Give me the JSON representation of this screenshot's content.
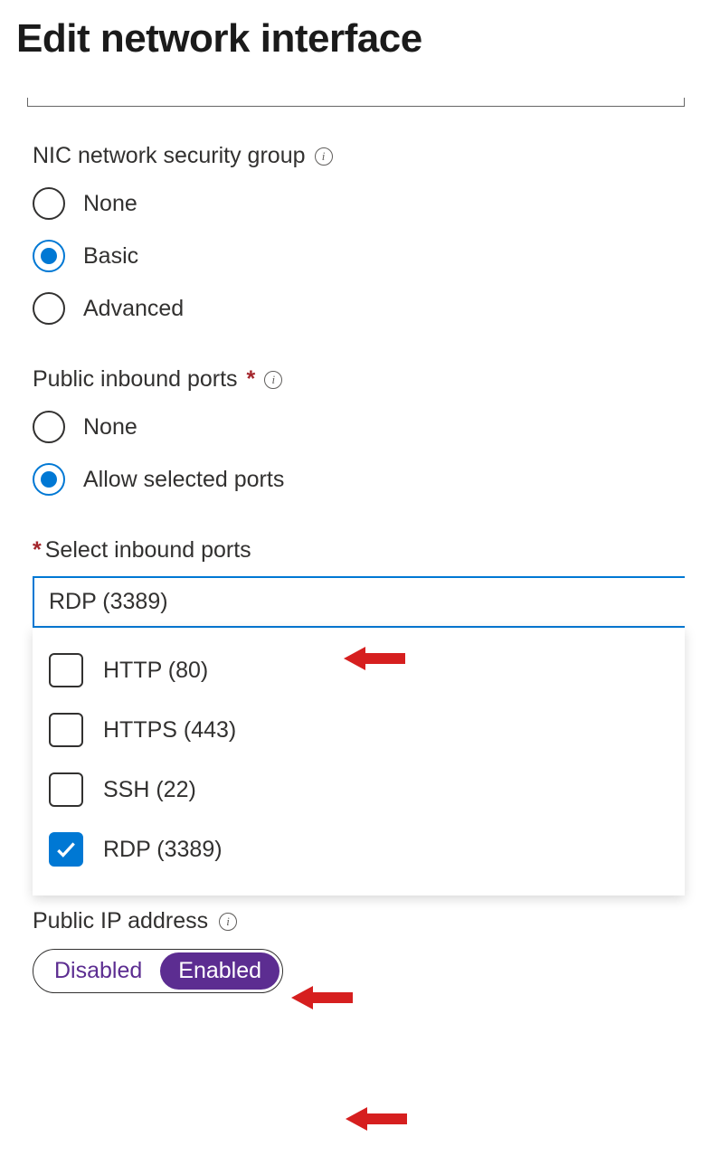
{
  "page_title": "Edit network interface",
  "nsg": {
    "label": "NIC network security group",
    "options": [
      "None",
      "Basic",
      "Advanced"
    ],
    "selected": "Basic"
  },
  "public_inbound": {
    "label": "Public inbound ports",
    "required_marker": "*",
    "options": [
      "None",
      "Allow selected ports"
    ],
    "selected": "Allow selected ports"
  },
  "select_ports": {
    "label": "Select inbound ports",
    "required_marker": "*",
    "value": "RDP (3389)",
    "options": [
      {
        "label": "HTTP (80)",
        "checked": false
      },
      {
        "label": "HTTPS (443)",
        "checked": false
      },
      {
        "label": "SSH (22)",
        "checked": false
      },
      {
        "label": "RDP (3389)",
        "checked": true
      }
    ]
  },
  "public_ip": {
    "label": "Public IP address",
    "options": [
      "Disabled",
      "Enabled"
    ],
    "selected": "Enabled"
  },
  "colors": {
    "accent_blue": "#0078d4",
    "required_red": "#a4262c",
    "toggle_purple": "#5c2d91",
    "arrow_red": "#d61f1f"
  }
}
